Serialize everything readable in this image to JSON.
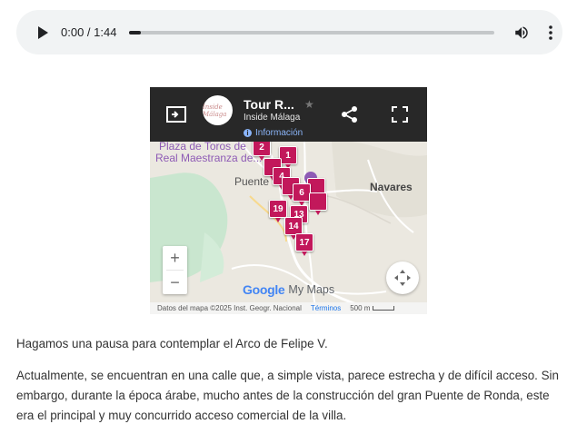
{
  "audio": {
    "time_display": "0:00 / 1:44",
    "progress": 0.03,
    "icons": {
      "play": "play-icon",
      "volume": "volume-icon",
      "more": "more-vertical-icon"
    }
  },
  "map": {
    "title": "Tour R...",
    "owner": "Inside Málaga",
    "info_label": "Información",
    "logo_text": "Inside Málaga",
    "place_labels": {
      "plaza": "Plaza de Toros de",
      "real": "Real Maestranza de...",
      "puente": "Puente",
      "navares": "Navares"
    },
    "markers": [
      "2",
      "1",
      "4",
      "6",
      "19",
      "13",
      "14",
      "17",
      "",
      "",
      "",
      ""
    ],
    "zoom_in": "+",
    "zoom_out": "−",
    "brand_google": "Google",
    "brand_mymaps": "My Maps",
    "attribution": "Datos del mapa ©2025 Inst. Geogr. Nacional",
    "terms": "Términos",
    "scale": "500 m",
    "colors": {
      "bar": "#282828",
      "marker": "#c2185b",
      "info": "#8ab4f8"
    }
  },
  "article": {
    "p1": "Hagamos una pausa para contemplar el Arco de Felipe V.",
    "p2_l1": "Actualmente, se encuentran en una calle que, a simple vista, parece estrecha y de difícil acceso. Sin",
    "p2_l2": "embargo, durante la época árabe, mucho antes de la construcción del gran Puente de Ronda, este",
    "p2_l3": "era el principal y muy concurrido acceso comercial de la villa."
  }
}
